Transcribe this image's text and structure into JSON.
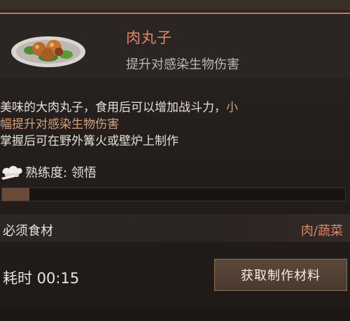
{
  "item": {
    "name": "肉丸子",
    "effect": "提升对感染生物伤害"
  },
  "description": {
    "line1_plain": "美味的大肉丸子，食用后可以增加战斗力，",
    "line1_highlight": "小",
    "line2_highlight": "幅提升对感染生物伤害",
    "line3": "掌握后可在野外篝火或壁炉上制作"
  },
  "proficiency": {
    "icon": "chef-hat-icon",
    "label": "熟练度: 领悟",
    "progress_fraction": 0.08
  },
  "ingredients": {
    "label": "必须食材",
    "value": "肉/蔬菜"
  },
  "cook_time": {
    "label": "耗时 00:15"
  },
  "action_button": {
    "label": "获取制作材料"
  },
  "colors": {
    "accent": "#e0866a",
    "highlight": "#d2a27c",
    "top_line": "#c9774a"
  }
}
